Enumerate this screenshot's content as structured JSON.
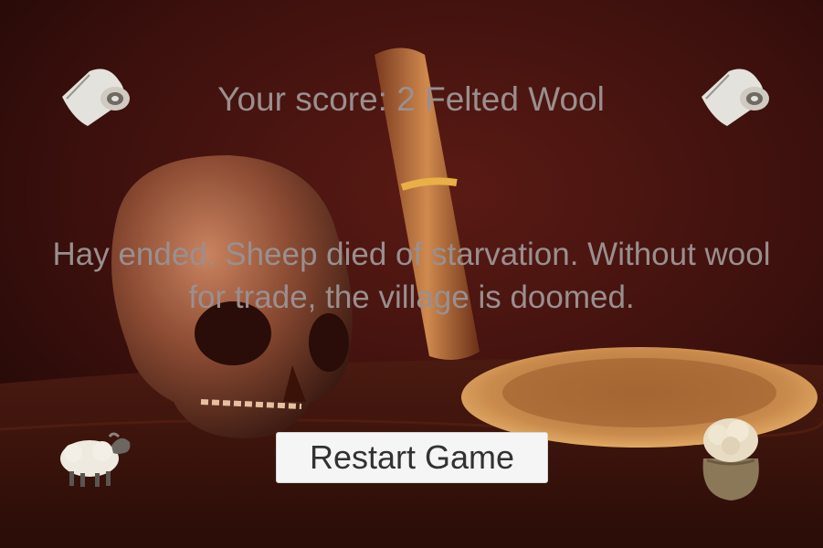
{
  "score_text": "Your score: 2 Felted Wool",
  "message_line1": "Hay ended. Sheep died of starvation. Without wool",
  "message_line2": "for trade, the village is doomed.",
  "restart_label": "Restart Game",
  "colors": {
    "background": "#3a0f0c",
    "overlay_text": "#9a8f8f",
    "button_bg": "#f5f5f5",
    "button_text": "#323232"
  },
  "icons": [
    "scroll-icon",
    "scroll-icon",
    "sheep-icon",
    "wool-sack-icon"
  ]
}
